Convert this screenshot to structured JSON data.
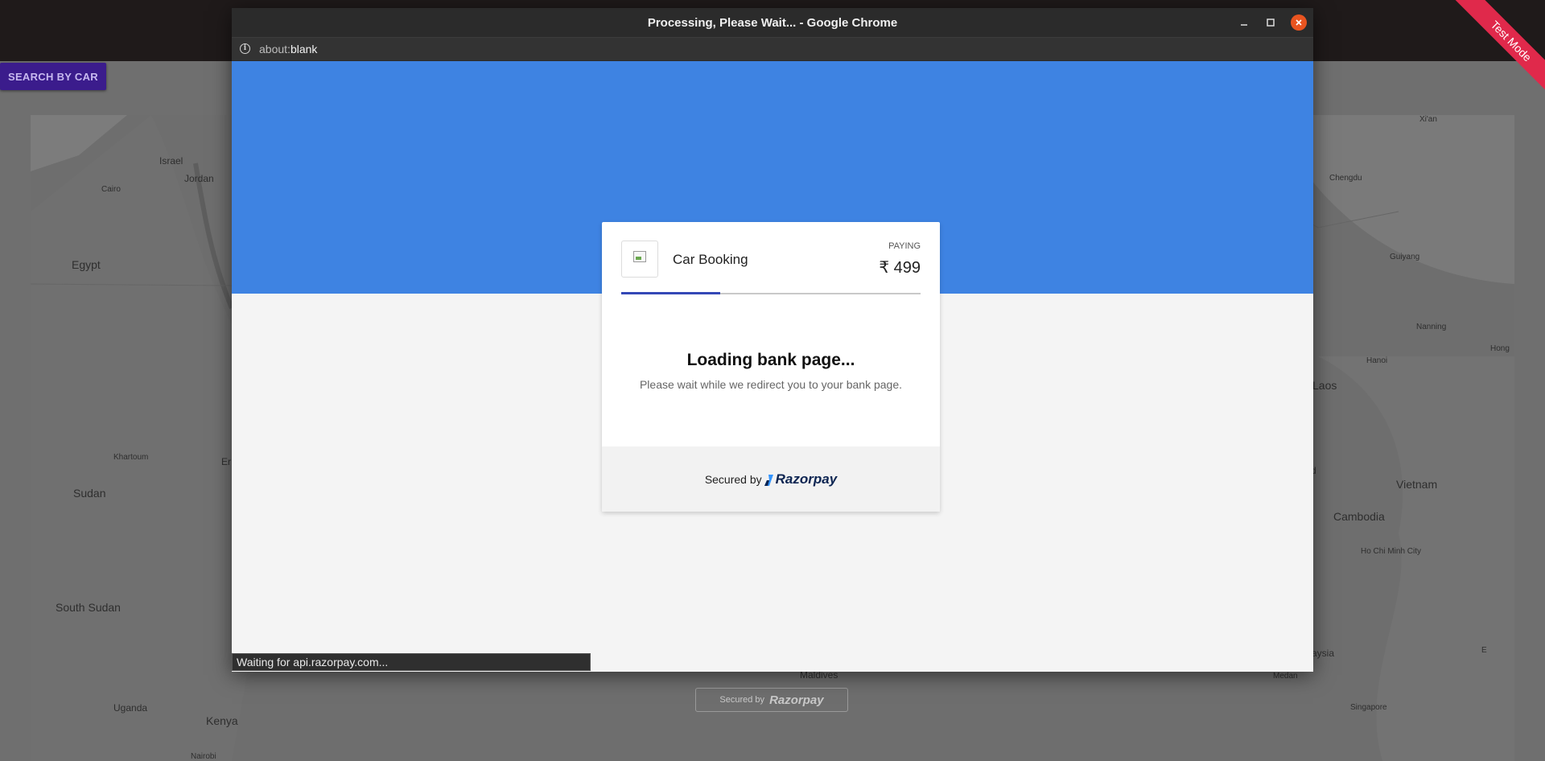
{
  "background_app": {
    "search_button_label": "SEARCH BY CAR",
    "test_ribbon_label": "Test Mode",
    "secured_by_label": "Secured by",
    "secured_brand": "Razorpay",
    "map_labels": {
      "israel": "Israel",
      "jordan": "Jordan",
      "cairo": "Cairo",
      "egypt": "Egypt",
      "khartoum": "Khartoum",
      "er": "Er",
      "sudan": "Sudan",
      "south_sudan": "South Sudan",
      "uganda": "Uganda",
      "kenya": "Kenya",
      "nairobi": "Nairobi",
      "maldives": "Maldives",
      "xian": "Xi'an",
      "chengdu": "Chengdu",
      "guiyang": "Guiyang",
      "nanning": "Nanning",
      "hong": "Hong",
      "hanoi": "Hanoi",
      "laos": "Laos",
      "d": "d",
      "vietnam": "Vietnam",
      "cambodia": "Cambodia",
      "hcmc": "Ho Chi Minh City",
      "aysia": "aysia",
      "medan": "Medan",
      "singapore": "Singapore",
      "e": "E"
    }
  },
  "popup": {
    "window_title": "Processing, Please Wait... - Google Chrome",
    "url_scheme": "about:",
    "url_host": "blank",
    "status_text": "Waiting for api.razorpay.com...",
    "colors": {
      "header_blue": "#3e83e2",
      "progress": "#3448b6",
      "close": "#e95420"
    }
  },
  "checkout": {
    "merchant_name": "Car Booking",
    "paying_label": "PAYING",
    "amount": "₹ 499",
    "progress_fraction": 0.33,
    "loading_title": "Loading bank page...",
    "loading_subtitle": "Please wait while we redirect you to your bank page.",
    "secured_by": "Secured by",
    "brand": "Razorpay"
  }
}
